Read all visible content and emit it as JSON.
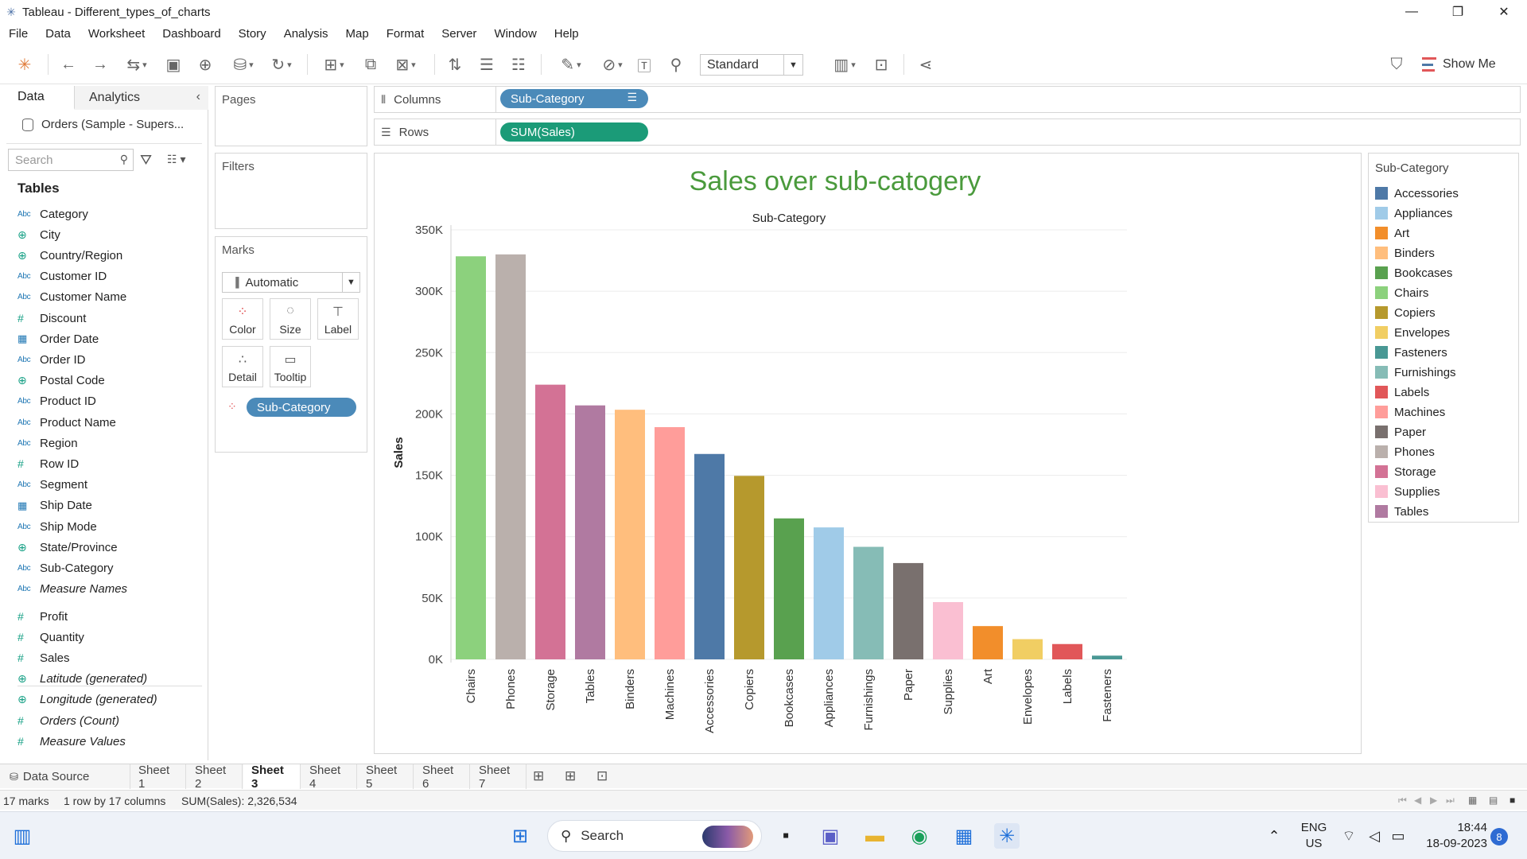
{
  "window": {
    "title": "Tableau - Different_types_of_charts"
  },
  "menu": [
    "File",
    "Data",
    "Worksheet",
    "Dashboard",
    "Story",
    "Analysis",
    "Map",
    "Format",
    "Server",
    "Window",
    "Help"
  ],
  "toolbar": {
    "fit_select": "Standard",
    "show_me": "Show Me"
  },
  "data_pane": {
    "tab_data": "Data",
    "tab_analytics": "Analytics",
    "datasource": "Orders (Sample - Supers...",
    "search_placeholder": "Search",
    "tables_heading": "Tables",
    "fields": [
      {
        "type": "Abc",
        "name": "Category"
      },
      {
        "type": "geo",
        "name": "City"
      },
      {
        "type": "geo",
        "name": "Country/Region"
      },
      {
        "type": "Abc",
        "name": "Customer ID"
      },
      {
        "type": "Abc",
        "name": "Customer Name"
      },
      {
        "type": "#",
        "name": "Discount"
      },
      {
        "type": "cal",
        "name": "Order Date"
      },
      {
        "type": "Abc",
        "name": "Order ID"
      },
      {
        "type": "geo",
        "name": "Postal Code"
      },
      {
        "type": "Abc",
        "name": "Product ID"
      },
      {
        "type": "Abc",
        "name": "Product Name"
      },
      {
        "type": "Abc",
        "name": "Region"
      },
      {
        "type": "#",
        "name": "Row ID"
      },
      {
        "type": "Abc",
        "name": "Segment"
      },
      {
        "type": "cal",
        "name": "Ship Date"
      },
      {
        "type": "Abc",
        "name": "Ship Mode"
      },
      {
        "type": "geo",
        "name": "State/Province"
      },
      {
        "type": "Abc",
        "name": "Sub-Category"
      },
      {
        "type": "Abc",
        "name": "Measure Names",
        "italic": true
      }
    ],
    "measures": [
      {
        "type": "#",
        "name": "Profit"
      },
      {
        "type": "#",
        "name": "Quantity"
      },
      {
        "type": "#",
        "name": "Sales"
      },
      {
        "type": "geo",
        "name": "Latitude (generated)",
        "italic": true
      },
      {
        "type": "geo",
        "name": "Longitude (generated)",
        "italic": true
      },
      {
        "type": "#",
        "name": "Orders (Count)",
        "italic": true
      },
      {
        "type": "#",
        "name": "Measure Values",
        "italic": true
      }
    ]
  },
  "cards": {
    "pages": "Pages",
    "filters": "Filters",
    "marks": "Marks",
    "mark_type": "Automatic",
    "buttons": [
      "Color",
      "Size",
      "Label",
      "Detail",
      "Tooltip"
    ],
    "color_pill": "Sub-Category"
  },
  "shelves": {
    "columns_label": "Columns",
    "columns_pill": "Sub-Category",
    "rows_label": "Rows",
    "rows_pill": "SUM(Sales)"
  },
  "legend": {
    "title": "Sub-Category",
    "items": [
      {
        "name": "Accessories",
        "color": "#4e79a7"
      },
      {
        "name": "Appliances",
        "color": "#a0cbe8"
      },
      {
        "name": "Art",
        "color": "#f28e2b"
      },
      {
        "name": "Binders",
        "color": "#ffbe7d"
      },
      {
        "name": "Bookcases",
        "color": "#59a14f"
      },
      {
        "name": "Chairs",
        "color": "#8cd17d"
      },
      {
        "name": "Copiers",
        "color": "#b6992d"
      },
      {
        "name": "Envelopes",
        "color": "#f1ce63"
      },
      {
        "name": "Fasteners",
        "color": "#499894"
      },
      {
        "name": "Furnishings",
        "color": "#86bcb6"
      },
      {
        "name": "Labels",
        "color": "#e15759"
      },
      {
        "name": "Machines",
        "color": "#ff9d9a"
      },
      {
        "name": "Paper",
        "color": "#79706e"
      },
      {
        "name": "Phones",
        "color": "#bab0ac"
      },
      {
        "name": "Storage",
        "color": "#d37295"
      },
      {
        "name": "Supplies",
        "color": "#fabfd2"
      },
      {
        "name": "Tables",
        "color": "#b07aa1"
      }
    ]
  },
  "chart_data": {
    "type": "bar",
    "title": "Sales over sub-catogery",
    "x_header": "Sub-Category",
    "ylabel": "Sales",
    "ylim": [
      0,
      350000
    ],
    "yticks": [
      0,
      50000,
      100000,
      150000,
      200000,
      250000,
      300000,
      350000
    ],
    "ytick_labels": [
      "0K",
      "50K",
      "100K",
      "150K",
      "200K",
      "250K",
      "300K",
      "350K"
    ],
    "grid": true,
    "categories": [
      "Chairs",
      "Phones",
      "Storage",
      "Tables",
      "Binders",
      "Machines",
      "Accessories",
      "Copiers",
      "Bookcases",
      "Appliances",
      "Furnishings",
      "Paper",
      "Supplies",
      "Art",
      "Envelopes",
      "Labels",
      "Fasteners"
    ],
    "values": [
      328449,
      330007,
      223844,
      206966,
      203413,
      189239,
      167380,
      149528,
      114880,
      107532,
      91705,
      78479,
      46674,
      27119,
      16476,
      12486,
      3024
    ],
    "colors": [
      "#8cd17d",
      "#bab0ac",
      "#d37295",
      "#b07aa1",
      "#ffbe7d",
      "#ff9d9a",
      "#4e79a7",
      "#b6992d",
      "#59a14f",
      "#a0cbe8",
      "#86bcb6",
      "#79706e",
      "#fabfd2",
      "#f28e2b",
      "#f1ce63",
      "#e15759",
      "#499894"
    ],
    "title_color": "#4a9a3c"
  },
  "sheets": {
    "data_source": "Data Source",
    "tabs": [
      "Sheet 1",
      "Sheet 2",
      "Sheet 3",
      "Sheet 4",
      "Sheet 5",
      "Sheet 6",
      "Sheet 7"
    ],
    "active": "Sheet 3"
  },
  "status": {
    "marks": "17 marks",
    "dims": "1 row by 17 columns",
    "sum": "SUM(Sales): 2,326,534"
  },
  "taskbar": {
    "search": "Search",
    "lang_top": "ENG",
    "lang_bottom": "US",
    "time": "18:44",
    "date": "18-09-2023",
    "notifications": "8"
  }
}
